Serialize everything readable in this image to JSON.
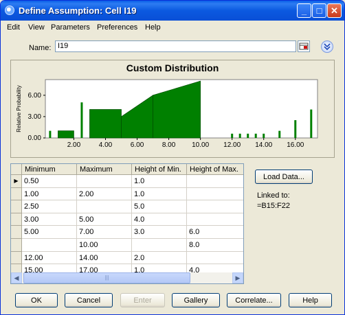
{
  "window": {
    "title": "Define Assumption: Cell I19"
  },
  "menu": [
    "Edit",
    "View",
    "Parameters",
    "Preferences",
    "Help"
  ],
  "name_field": {
    "label": "Name:",
    "value": "I19"
  },
  "chart_data": {
    "type": "bar",
    "title": "Custom Distribution",
    "ylabel": "Relative Probability",
    "xlabel": "",
    "xlim": [
      0.2,
      17.4
    ],
    "ylim": [
      0,
      8.2
    ],
    "x_ticks": [
      2,
      4,
      6,
      8,
      10,
      12,
      14,
      16
    ],
    "x_tick_labels": [
      "2.00",
      "4.00",
      "6.00",
      "8.00",
      "10.00",
      "12.00",
      "14.00",
      "16.00"
    ],
    "y_ticks": [
      0,
      3,
      6
    ],
    "y_tick_labels": [
      "0.00",
      "3.00",
      "6.00"
    ],
    "grid": false,
    "color": "#008000",
    "ranges": [
      {
        "x0": 1.0,
        "x1": 2.0,
        "y0": 1.0,
        "y1": 1.0
      },
      {
        "x0": 3.0,
        "x1": 5.0,
        "y0": 4.0,
        "y1": 4.0
      },
      {
        "x0": 5.0,
        "x1": 7.0,
        "y0": 3.0,
        "y1": 6.0
      },
      {
        "x0": 7.0,
        "x1": 10.0,
        "y0": 6.0,
        "y1": 8.0
      }
    ],
    "spikes": [
      {
        "x": 0.5,
        "y": 1.0
      },
      {
        "x": 2.5,
        "y": 5.0
      },
      {
        "x": 12.0,
        "y": 0.6
      },
      {
        "x": 12.5,
        "y": 0.6
      },
      {
        "x": 13.0,
        "y": 0.6
      },
      {
        "x": 13.5,
        "y": 0.6
      },
      {
        "x": 14.0,
        "y": 0.6
      },
      {
        "x": 15.0,
        "y": 1.0
      },
      {
        "x": 16.0,
        "y": 2.5
      },
      {
        "x": 17.0,
        "y": 4.0
      }
    ]
  },
  "grid": {
    "columns": [
      "Minimum",
      "Maximum",
      "Height of Min.",
      "Height of Max."
    ],
    "rows": [
      [
        "0.50",
        "",
        "1.0",
        ""
      ],
      [
        "1.00",
        "2.00",
        "1.0",
        ""
      ],
      [
        "2.50",
        "",
        "5.0",
        ""
      ],
      [
        "3.00",
        "5.00",
        "4.0",
        ""
      ],
      [
        "5.00",
        "7.00",
        "3.0",
        "6.0"
      ],
      [
        "",
        "10.00",
        "",
        "8.0"
      ],
      [
        "12.00",
        "14.00",
        "2.0",
        ""
      ],
      [
        "15.00",
        "17.00",
        "1.0",
        "4.0"
      ]
    ],
    "current_row_marker": "▶"
  },
  "side": {
    "load_button": "Load Data...",
    "linked_label": "Linked to:",
    "linked_value": "=B15:F22"
  },
  "buttons": {
    "ok": "OK",
    "cancel": "Cancel",
    "enter": "Enter",
    "gallery": "Gallery",
    "correlate": "Correlate...",
    "help": "Help"
  },
  "scrollbar": {
    "thumb_grip": "|||"
  }
}
